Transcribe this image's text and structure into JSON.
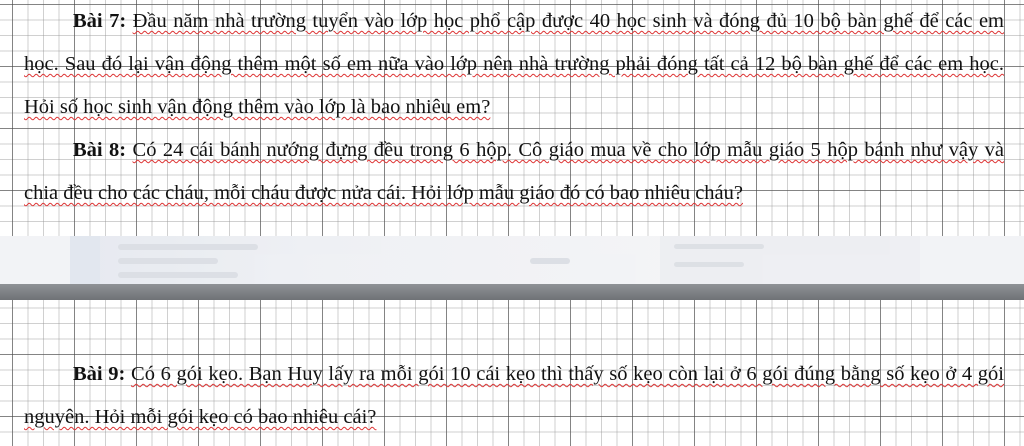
{
  "problems": [
    {
      "label": "Bài 7:",
      "text": "Đầu năm nhà trường tuyển vào lớp học phổ cập được 40 học sinh và đóng đủ 10 bộ bàn ghế để các em học. Sau đó lại vận động thêm một số em nữa vào lớp nên nhà trường phải đóng tất cả 12 bộ bàn ghế để các em học. Hỏi số học sinh vận động thêm vào lớp là bao nhiêu em?"
    },
    {
      "label": "Bài 8:",
      "text": "Có 24 cái bánh nướng đựng đều trong 6 hộp. Cô giáo mua về cho lớp mẫu giáo 5 hộp bánh như vậy và chia đều cho các cháu, mỗi cháu được nửa cái. Hỏi lớp mẫu giáo đó có bao nhiêu cháu?"
    },
    {
      "label": "Bài 9:",
      "text": "Có 6 gói kẹo. Bạn Huy lấy ra mỗi gói 10 cái kẹo thì thấy số kẹo còn lại ở 6 gói đúng bằng số kẹo ở 4 gói nguyên. Hỏi mỗi gói kẹo có bao nhiêu cái?"
    }
  ],
  "colors": {
    "grid": "#8a8a8a",
    "spellcheck_underline": "#d33333",
    "separator": "#7a7d81"
  }
}
